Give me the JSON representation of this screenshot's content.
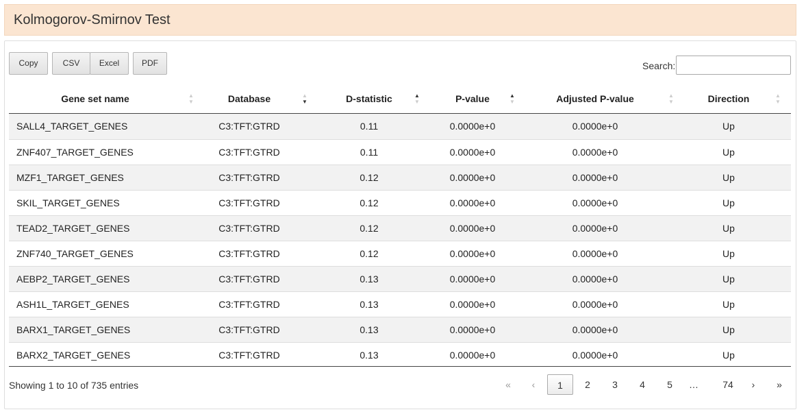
{
  "panel_title": "Kolmogorov-Smirnov Test",
  "buttons": {
    "copy": "Copy",
    "csv": "CSV",
    "excel": "Excel",
    "pdf": "PDF"
  },
  "search": {
    "label": "Search:",
    "value": "",
    "placeholder": ""
  },
  "columns": [
    {
      "label": "Gene set name",
      "sort": "none"
    },
    {
      "label": "Database",
      "sort": "desc"
    },
    {
      "label": "D-statistic",
      "sort": "asc"
    },
    {
      "label": "P-value",
      "sort": "asc"
    },
    {
      "label": "Adjusted P-value",
      "sort": "none"
    },
    {
      "label": "Direction",
      "sort": "none"
    }
  ],
  "rows": [
    [
      "SALL4_TARGET_GENES",
      "C3:TFT:GTRD",
      "0.11",
      "0.0000e+0",
      "0.0000e+0",
      "Up"
    ],
    [
      "ZNF407_TARGET_GENES",
      "C3:TFT:GTRD",
      "0.11",
      "0.0000e+0",
      "0.0000e+0",
      "Up"
    ],
    [
      "MZF1_TARGET_GENES",
      "C3:TFT:GTRD",
      "0.12",
      "0.0000e+0",
      "0.0000e+0",
      "Up"
    ],
    [
      "SKIL_TARGET_GENES",
      "C3:TFT:GTRD",
      "0.12",
      "0.0000e+0",
      "0.0000e+0",
      "Up"
    ],
    [
      "TEAD2_TARGET_GENES",
      "C3:TFT:GTRD",
      "0.12",
      "0.0000e+0",
      "0.0000e+0",
      "Up"
    ],
    [
      "ZNF740_TARGET_GENES",
      "C3:TFT:GTRD",
      "0.12",
      "0.0000e+0",
      "0.0000e+0",
      "Up"
    ],
    [
      "AEBP2_TARGET_GENES",
      "C3:TFT:GTRD",
      "0.13",
      "0.0000e+0",
      "0.0000e+0",
      "Up"
    ],
    [
      "ASH1L_TARGET_GENES",
      "C3:TFT:GTRD",
      "0.13",
      "0.0000e+0",
      "0.0000e+0",
      "Up"
    ],
    [
      "BARX1_TARGET_GENES",
      "C3:TFT:GTRD",
      "0.13",
      "0.0000e+0",
      "0.0000e+0",
      "Up"
    ],
    [
      "BARX2_TARGET_GENES",
      "C3:TFT:GTRD",
      "0.13",
      "0.0000e+0",
      "0.0000e+0",
      "Up"
    ]
  ],
  "info": "Showing 1 to 10 of 735 entries",
  "pagination": {
    "first": "«",
    "prev": "‹",
    "pages": [
      "1",
      "2",
      "3",
      "4",
      "5",
      "…",
      "74"
    ],
    "current": "1",
    "next": "›",
    "last": "»"
  }
}
